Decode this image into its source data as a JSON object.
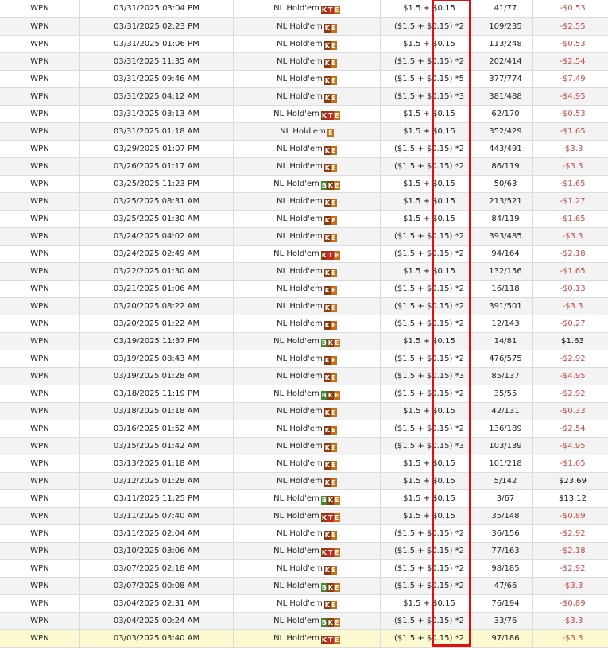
{
  "colors": {
    "negative": "#c0504d",
    "selected_row": "#fbf9cf",
    "highlight_box": "#e01010"
  },
  "rows": [
    {
      "site": "WPN",
      "date": "03/31/2025 03:04 PM",
      "game": "NL Hold'em",
      "badges": [
        "k",
        "t",
        "e"
      ],
      "buyin": "$1.5 + $0.15",
      "position": "41/77",
      "result": "-$0.53"
    },
    {
      "site": "WPN",
      "date": "03/31/2025 02:23 PM",
      "game": "NL Hold'em",
      "badges": [
        "k",
        "e"
      ],
      "buyin": "($1.5 + $0.15) *2",
      "position": "109/235",
      "result": "-$2.55"
    },
    {
      "site": "WPN",
      "date": "03/31/2025 01:06 PM",
      "game": "NL Hold'em",
      "badges": [
        "k",
        "e"
      ],
      "buyin": "$1.5 + $0.15",
      "position": "113/248",
      "result": "-$0.53"
    },
    {
      "site": "WPN",
      "date": "03/31/2025 11:35 AM",
      "game": "NL Hold'em",
      "badges": [
        "k",
        "e"
      ],
      "buyin": "($1.5 + $0.15) *2",
      "position": "202/414",
      "result": "-$2.54"
    },
    {
      "site": "WPN",
      "date": "03/31/2025 09:46 AM",
      "game": "NL Hold'em",
      "badges": [
        "k",
        "e"
      ],
      "buyin": "($1.5 + $0.15) *5",
      "position": "377/774",
      "result": "-$7.49"
    },
    {
      "site": "WPN",
      "date": "03/31/2025 04:12 AM",
      "game": "NL Hold'em",
      "badges": [
        "k",
        "e"
      ],
      "buyin": "($1.5 + $0.15) *3",
      "position": "381/488",
      "result": "-$4.95"
    },
    {
      "site": "WPN",
      "date": "03/31/2025 03:13 AM",
      "game": "NL Hold'em",
      "badges": [
        "k",
        "t",
        "e"
      ],
      "buyin": "$1.5 + $0.15",
      "position": "62/170",
      "result": "-$0.53"
    },
    {
      "site": "WPN",
      "date": "03/31/2025 01:18 AM",
      "game": "NL Hold'em",
      "badges": [
        "e"
      ],
      "buyin": "$1.5 + $0.15",
      "position": "352/429",
      "result": "-$1.65"
    },
    {
      "site": "WPN",
      "date": "03/29/2025 01:07 PM",
      "game": "NL Hold'em",
      "badges": [
        "k",
        "e"
      ],
      "buyin": "($1.5 + $0.15) *2",
      "position": "443/491",
      "result": "-$3.3"
    },
    {
      "site": "WPN",
      "date": "03/26/2025 01:17 AM",
      "game": "NL Hold'em",
      "badges": [
        "k",
        "e"
      ],
      "buyin": "($1.5 + $0.15) *2",
      "position": "86/119",
      "result": "-$3.3"
    },
    {
      "site": "WPN",
      "date": "03/25/2025 11:23 PM",
      "game": "NL Hold'em",
      "badges": [
        "b",
        "k",
        "e"
      ],
      "buyin": "$1.5 + $0.15",
      "position": "50/63",
      "result": "-$1.65"
    },
    {
      "site": "WPN",
      "date": "03/25/2025 08:31 AM",
      "game": "NL Hold'em",
      "badges": [
        "k",
        "e"
      ],
      "buyin": "$1.5 + $0.15",
      "position": "213/521",
      "result": "-$1.27"
    },
    {
      "site": "WPN",
      "date": "03/25/2025 01:30 AM",
      "game": "NL Hold'em",
      "badges": [
        "k",
        "e"
      ],
      "buyin": "$1.5 + $0.15",
      "position": "84/119",
      "result": "-$1.65"
    },
    {
      "site": "WPN",
      "date": "03/24/2025 04:02 AM",
      "game": "NL Hold'em",
      "badges": [
        "k",
        "e"
      ],
      "buyin": "($1.5 + $0.15) *2",
      "position": "393/485",
      "result": "-$3.3"
    },
    {
      "site": "WPN",
      "date": "03/24/2025 02:49 AM",
      "game": "NL Hold'em",
      "badges": [
        "k",
        "t",
        "e"
      ],
      "buyin": "($1.5 + $0.15) *2",
      "position": "94/164",
      "result": "-$2.18"
    },
    {
      "site": "WPN",
      "date": "03/22/2025 01:30 AM",
      "game": "NL Hold'em",
      "badges": [
        "k",
        "e"
      ],
      "buyin": "$1.5 + $0.15",
      "position": "132/156",
      "result": "-$1.65"
    },
    {
      "site": "WPN",
      "date": "03/21/2025 01:06 AM",
      "game": "NL Hold'em",
      "badges": [
        "k",
        "e"
      ],
      "buyin": "($1.5 + $0.15) *2",
      "position": "16/118",
      "result": "-$0.13"
    },
    {
      "site": "WPN",
      "date": "03/20/2025 08:22 AM",
      "game": "NL Hold'em",
      "badges": [
        "k",
        "e"
      ],
      "buyin": "($1.5 + $0.15) *2",
      "position": "391/501",
      "result": "-$3.3"
    },
    {
      "site": "WPN",
      "date": "03/20/2025 01:22 AM",
      "game": "NL Hold'em",
      "badges": [
        "k",
        "e"
      ],
      "buyin": "($1.5 + $0.15) *2",
      "position": "12/143",
      "result": "-$0.27"
    },
    {
      "site": "WPN",
      "date": "03/19/2025 11:37 PM",
      "game": "NL Hold'em",
      "badges": [
        "b",
        "k",
        "e"
      ],
      "buyin": "$1.5 + $0.15",
      "position": "14/81",
      "result": "$1.63"
    },
    {
      "site": "WPN",
      "date": "03/19/2025 08:43 AM",
      "game": "NL Hold'em",
      "badges": [
        "k",
        "e"
      ],
      "buyin": "($1.5 + $0.15) *2",
      "position": "476/575",
      "result": "-$2.92"
    },
    {
      "site": "WPN",
      "date": "03/19/2025 01:28 AM",
      "game": "NL Hold'em",
      "badges": [
        "k",
        "e"
      ],
      "buyin": "($1.5 + $0.15) *3",
      "position": "85/137",
      "result": "-$4.95"
    },
    {
      "site": "WPN",
      "date": "03/18/2025 11:19 PM",
      "game": "NL Hold'em",
      "badges": [
        "b",
        "k",
        "e"
      ],
      "buyin": "($1.5 + $0.15) *2",
      "position": "35/55",
      "result": "-$2.92"
    },
    {
      "site": "WPN",
      "date": "03/18/2025 01:18 AM",
      "game": "NL Hold'em",
      "badges": [
        "k",
        "e"
      ],
      "buyin": "$1.5 + $0.15",
      "position": "42/131",
      "result": "-$0.33"
    },
    {
      "site": "WPN",
      "date": "03/16/2025 01:52 AM",
      "game": "NL Hold'em",
      "badges": [
        "k",
        "e"
      ],
      "buyin": "($1.5 + $0.15) *2",
      "position": "136/189",
      "result": "-$2.54"
    },
    {
      "site": "WPN",
      "date": "03/15/2025 01:42 AM",
      "game": "NL Hold'em",
      "badges": [
        "k",
        "e"
      ],
      "buyin": "($1.5 + $0.15) *3",
      "position": "103/139",
      "result": "-$4.95"
    },
    {
      "site": "WPN",
      "date": "03/13/2025 01:18 AM",
      "game": "NL Hold'em",
      "badges": [
        "k",
        "e"
      ],
      "buyin": "$1.5 + $0.15",
      "position": "101/218",
      "result": "-$1.65"
    },
    {
      "site": "WPN",
      "date": "03/12/2025 01:28 AM",
      "game": "NL Hold'em",
      "badges": [
        "k",
        "e"
      ],
      "buyin": "$1.5 + $0.15",
      "position": "5/142",
      "result": "$23.69"
    },
    {
      "site": "WPN",
      "date": "03/11/2025 11:25 PM",
      "game": "NL Hold'em",
      "badges": [
        "b",
        "k",
        "e"
      ],
      "buyin": "$1.5 + $0.15",
      "position": "3/67",
      "result": "$13.12"
    },
    {
      "site": "WPN",
      "date": "03/11/2025 07:40 AM",
      "game": "NL Hold'em",
      "badges": [
        "k",
        "t",
        "e"
      ],
      "buyin": "$1.5 + $0.15",
      "position": "35/148",
      "result": "-$0.89"
    },
    {
      "site": "WPN",
      "date": "03/11/2025 02:04 AM",
      "game": "NL Hold'em",
      "badges": [
        "k",
        "e"
      ],
      "buyin": "($1.5 + $0.15) *2",
      "position": "36/156",
      "result": "-$2.92"
    },
    {
      "site": "WPN",
      "date": "03/10/2025 03:06 AM",
      "game": "NL Hold'em",
      "badges": [
        "k",
        "t",
        "e"
      ],
      "buyin": "($1.5 + $0.15) *2",
      "position": "77/163",
      "result": "-$2.18"
    },
    {
      "site": "WPN",
      "date": "03/07/2025 02:18 AM",
      "game": "NL Hold'em",
      "badges": [
        "k",
        "e"
      ],
      "buyin": "($1.5 + $0.15) *2",
      "position": "98/185",
      "result": "-$2.92"
    },
    {
      "site": "WPN",
      "date": "03/07/2025 00:08 AM",
      "game": "NL Hold'em",
      "badges": [
        "b",
        "k",
        "e"
      ],
      "buyin": "($1.5 + $0.15) *2",
      "position": "47/66",
      "result": "-$3.3"
    },
    {
      "site": "WPN",
      "date": "03/04/2025 02:31 AM",
      "game": "NL Hold'em",
      "badges": [
        "k",
        "e"
      ],
      "buyin": "$1.5 + $0.15",
      "position": "76/194",
      "result": "-$0.89"
    },
    {
      "site": "WPN",
      "date": "03/04/2025 00:24 AM",
      "game": "NL Hold'em",
      "badges": [
        "b",
        "k",
        "e"
      ],
      "buyin": "($1.5 + $0.15) *2",
      "position": "33/76",
      "result": "-$3.3"
    },
    {
      "site": "WPN",
      "date": "03/03/2025 03:40 AM",
      "game": "NL Hold'em",
      "badges": [
        "k",
        "t",
        "e"
      ],
      "buyin": "($1.5 + $0.15) *2",
      "position": "97/186",
      "result": "-$3.3",
      "selected": true
    }
  ]
}
